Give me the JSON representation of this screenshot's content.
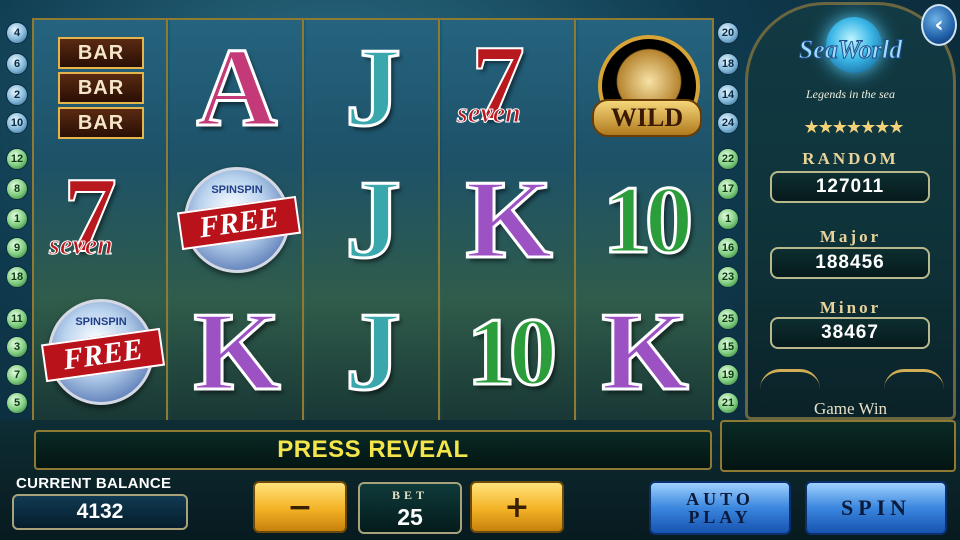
{
  "paylines": {
    "left": [
      "4",
      "6",
      "2",
      "10",
      "12",
      "8",
      "1",
      "9",
      "18",
      "11",
      "3",
      "7",
      "5"
    ],
    "right": [
      "20",
      "18",
      "14",
      "24",
      "22",
      "17",
      "1",
      "16",
      "23",
      "25",
      "15",
      "19",
      "21"
    ]
  },
  "reels": [
    [
      "BAR",
      "7",
      "FREE"
    ],
    [
      "A",
      "FREE",
      "K"
    ],
    [
      "J",
      "J",
      "J"
    ],
    [
      "7",
      "K",
      "10"
    ],
    [
      "WILD",
      "10",
      "K"
    ]
  ],
  "symbols": {
    "bar": [
      "BAR",
      "BAR",
      "BAR"
    ],
    "seven_word": "seven",
    "free_top": "SPINSPIN",
    "free_word": "FREE",
    "wild_word": "WILD"
  },
  "panel": {
    "logo": "SeaWorld",
    "tagline": "Legends in the sea",
    "stars": "★★★★★★★",
    "random_label": "RANDOM",
    "random_value": "127011",
    "major_label": "Major",
    "major_value": "188456",
    "minor_label": "Minor",
    "minor_value": "38467",
    "game_win_label": "Game Win"
  },
  "back_icon": "‹",
  "message": "PRESS REVEAL",
  "balance": {
    "label": "CURRENT BALANCE",
    "value": "4132"
  },
  "bet": {
    "label": "BET",
    "value": "25",
    "minus": "−",
    "plus": "+"
  },
  "buttons": {
    "auto_line1": "AUTO",
    "auto_line2": "PLAY",
    "spin": "SPIN"
  }
}
